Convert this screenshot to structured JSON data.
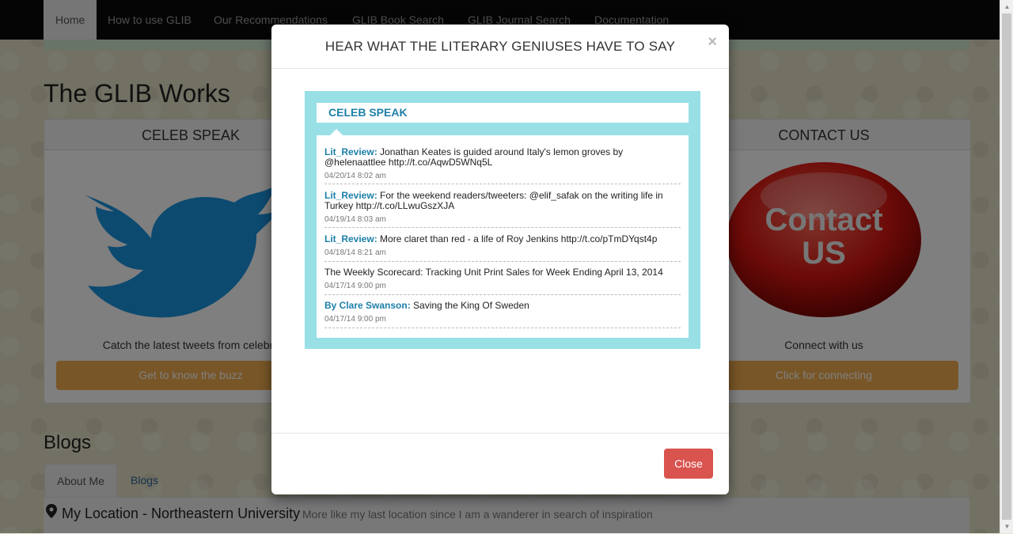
{
  "navbar": {
    "items": [
      "Home",
      "How to use GLIB",
      "Our Recommendations",
      "GLIB Book Search",
      "GLIB Journal Search",
      "Documentation"
    ]
  },
  "page": {
    "title": "The GLIB Works",
    "panels": [
      {
        "heading": "CELEB SPEAK",
        "text": "Catch the latest tweets from celebrit",
        "button": "Get to know the buzz"
      },
      {
        "heading": "CONTACT US",
        "text": "Connect with us",
        "button": "Click for connecting"
      }
    ],
    "contact_image_text": [
      "Contact",
      "US"
    ],
    "blogs_title": "Blogs",
    "tabs": [
      "About Me",
      "Blogs"
    ],
    "location_label": "My Location - Northeastern University",
    "location_sub": "More like my last location since I am a wanderer in search of inspiration"
  },
  "modal": {
    "title": "HEAR WHAT THE LITERARY GENIUSES HAVE TO SAY",
    "close_x": "×",
    "close_button": "Close",
    "widget": {
      "heading": "CELEB SPEAK",
      "tweets": [
        {
          "author": "Lit_Review:",
          "text": " Jonathan Keates is guided around Italy's lemon groves by @helenaattlee http://t.co/AqwD5WNq5L",
          "time": "04/20/14 8:02 am"
        },
        {
          "author": "Lit_Review:",
          "text": " For the weekend readers/tweeters: @elif_safak on the writing life in Turkey http://t.co/LLwuGszXJA",
          "time": "04/19/14 8:03 am"
        },
        {
          "author": "Lit_Review:",
          "text": " More claret than red - a life of Roy Jenkins http://t.co/pTmDYqst4p",
          "time": "04/18/14 8:21 am"
        },
        {
          "author": "",
          "text": "The Weekly Scorecard: Tracking Unit Print Sales for Week Ending April 13, 2014",
          "time": "04/17/14 9:00 pm"
        },
        {
          "author": "By Clare Swanson:",
          "text": " Saving the King Of Sweden",
          "time": "04/17/14 9:00 pm"
        }
      ]
    }
  },
  "colors": {
    "accent": "#f0ad4e",
    "danger": "#d9534f",
    "widget": "#98e0e6",
    "link": "#1d7fa8"
  }
}
